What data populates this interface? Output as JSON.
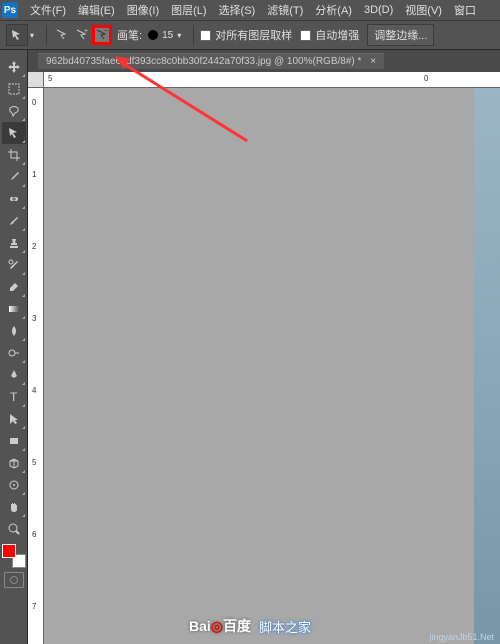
{
  "menubar": {
    "items": [
      "文件(F)",
      "编辑(E)",
      "图像(I)",
      "图层(L)",
      "选择(S)",
      "滤镜(T)",
      "分析(A)",
      "3D(D)",
      "视图(V)",
      "窗口"
    ]
  },
  "optbar": {
    "brush_label": "画笔:",
    "brush_size": "15",
    "sample_all_label": "对所有图层取样",
    "auto_enhance_label": "自动增强",
    "refine_edge_label": "调整边缘..."
  },
  "tab": {
    "filename": "962bd40735fae6cdf393cc8c0bb30f2442a70f33.jpg",
    "zoom_mode": "@ 100%(RGB/8#) *",
    "close": "×"
  },
  "rulers": {
    "h": [
      "5",
      "0"
    ],
    "v": [
      "0",
      "1",
      "2",
      "3",
      "4",
      "5",
      "6",
      "7"
    ]
  },
  "tools": [
    "move",
    "marquee",
    "lasso",
    "quick-select",
    "crop",
    "eyedropper",
    "healing",
    "brush",
    "stamp",
    "history-brush",
    "eraser",
    "gradient",
    "blur",
    "dodge",
    "pen",
    "type",
    "path-select",
    "rectangle",
    "hand",
    "zoom"
  ],
  "watermark": {
    "baidu": "Bai",
    "baidu2": "百度",
    "site": "脚本之家",
    "url": "jingyanJb51.Net"
  }
}
